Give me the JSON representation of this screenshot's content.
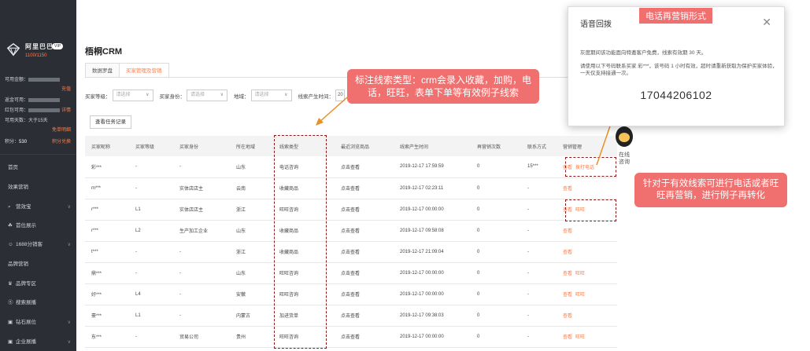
{
  "sidebar": {
    "brand_name": "阿里巴巴",
    "brand_badge": "VIP",
    "brand_count": "1100/1150",
    "usable_label": "可用金额：",
    "charge_link": "充值",
    "reward_label": "返金可用：",
    "red_packet_label": "红包可用：",
    "detail_link": "详情",
    "days_label": "可用天数：大于15天",
    "free_link": "免单明细",
    "points_label": "积分：",
    "points_value": "530",
    "points_link": "积分兑换",
    "menu": [
      {
        "label": "首页",
        "icon": ""
      },
      {
        "label": "效果营销",
        "icon": ""
      },
      {
        "label": "营效宝",
        "icon": "magnifier"
      },
      {
        "label": "首位展示",
        "icon": "sprout"
      },
      {
        "label": "1688分销客",
        "icon": "people"
      },
      {
        "label": "品牌营销",
        "icon": ""
      },
      {
        "label": "品牌专区",
        "icon": "crown"
      },
      {
        "label": "搜索展播",
        "icon": "s-box"
      },
      {
        "label": "钻石展位",
        "icon": "monitor"
      },
      {
        "label": "企业展播",
        "icon": "monitor"
      }
    ]
  },
  "main": {
    "title": "梧桐CRM",
    "tabs": [
      {
        "label": "数据罗盘"
      },
      {
        "label": "买家管理及营销"
      }
    ],
    "filters": {
      "level_label": "买家等级：",
      "identity_label": "买家身份：",
      "region_label": "地域：",
      "time_label": "线索产生时间：",
      "placeholder": "请选择",
      "date_prefix": "20"
    },
    "task_button": "查看任务记录",
    "table": {
      "headers": [
        "买家昵称",
        "买家等级",
        "买家身份",
        "所在地域",
        "线索类型",
        "最近浏览商品",
        "线索产生时间",
        "再营销次数",
        "联系方式",
        "营销管理"
      ],
      "rows": [
        {
          "nick": "彩***",
          "level": "-",
          "identity": "-",
          "region": "山东",
          "type": "电话咨询",
          "goods": "点击查看",
          "time": "2019-12-17 17:59:59",
          "count": "0",
          "contact": "15***",
          "action1": "查看",
          "action2": "拨打电话"
        },
        {
          "nick": "m***",
          "level": "-",
          "identity": "实体店店主",
          "region": "云南",
          "type": "收藏商品",
          "goods": "点击查看",
          "time": "2019-12-17 02:23:11",
          "count": "0",
          "contact": "-",
          "action1": "查看",
          "action2": ""
        },
        {
          "nick": "r***",
          "level": "L1",
          "identity": "实体店店主",
          "region": "浙江",
          "type": "旺旺咨询",
          "goods": "点击查看",
          "time": "2019-12-17 00:00:00",
          "count": "0",
          "contact": "-",
          "action1": "查看",
          "action2": "旺旺"
        },
        {
          "nick": "r***",
          "level": "L2",
          "identity": "生产加工企业",
          "region": "山东",
          "type": "收藏商品",
          "goods": "点击查看",
          "time": "2019-12-17 09:58:08",
          "count": "0",
          "contact": "-",
          "action1": "查看",
          "action2": ""
        },
        {
          "nick": "t***",
          "level": "-",
          "identity": "-",
          "region": "浙江",
          "type": "收藏商品",
          "goods": "点击查看",
          "time": "2019-12-17 21:09:04",
          "count": "0",
          "contact": "-",
          "action1": "查看",
          "action2": ""
        },
        {
          "nick": "鼎***",
          "level": "-",
          "identity": "-",
          "region": "山东",
          "type": "旺旺咨询",
          "goods": "点击查看",
          "time": "2019-12-17 00:00:00",
          "count": "0",
          "contact": "-",
          "action1": "查看",
          "action2": "旺旺"
        },
        {
          "nick": "好***",
          "level": "L4",
          "identity": "-",
          "region": "安徽",
          "type": "旺旺咨询",
          "goods": "点击查看",
          "time": "2019-12-17 00:00:00",
          "count": "0",
          "contact": "-",
          "action1": "查看",
          "action2": "旺旺"
        },
        {
          "nick": "豪***",
          "level": "L1",
          "identity": "-",
          "region": "内蒙古",
          "type": "加进货单",
          "goods": "点击查看",
          "time": "2019-12-17 09:38:03",
          "count": "0",
          "contact": "-",
          "action1": "查看",
          "action2": ""
        },
        {
          "nick": "东***",
          "level": "-",
          "identity": "贸易公司",
          "region": "贵州",
          "type": "旺旺咨询",
          "goods": "点击查看",
          "time": "2019-12-17 00:00:00",
          "count": "0",
          "contact": "-",
          "action1": "查看",
          "action2": "旺旺"
        }
      ]
    }
  },
  "popup": {
    "title": "语音回拨",
    "tag": "电话再营销形式",
    "line1": "灰度期间该功能面向特邀客户免费，线索有效期 30 天。",
    "line2": "请使用以下号码联系买家 彩***，该号码 1 小时有效，超时请重新获取为保护买家体验，一天仅支持接通一次。",
    "phone": "17044206102"
  },
  "online": {
    "label": "在线咨询"
  },
  "annotations": {
    "callout1": "标注线索类型：crm会录入收藏，加购，电话，旺旺，表单下单等有效例子线索",
    "callout2": "针对于有效线索可进行电话或者旺旺再营销，进行例子再转化"
  },
  "colors": {
    "accent": "#ff7a45",
    "sidebar": "#2b2e35",
    "callout": "#f07070",
    "dash": "#8b1a1a"
  }
}
